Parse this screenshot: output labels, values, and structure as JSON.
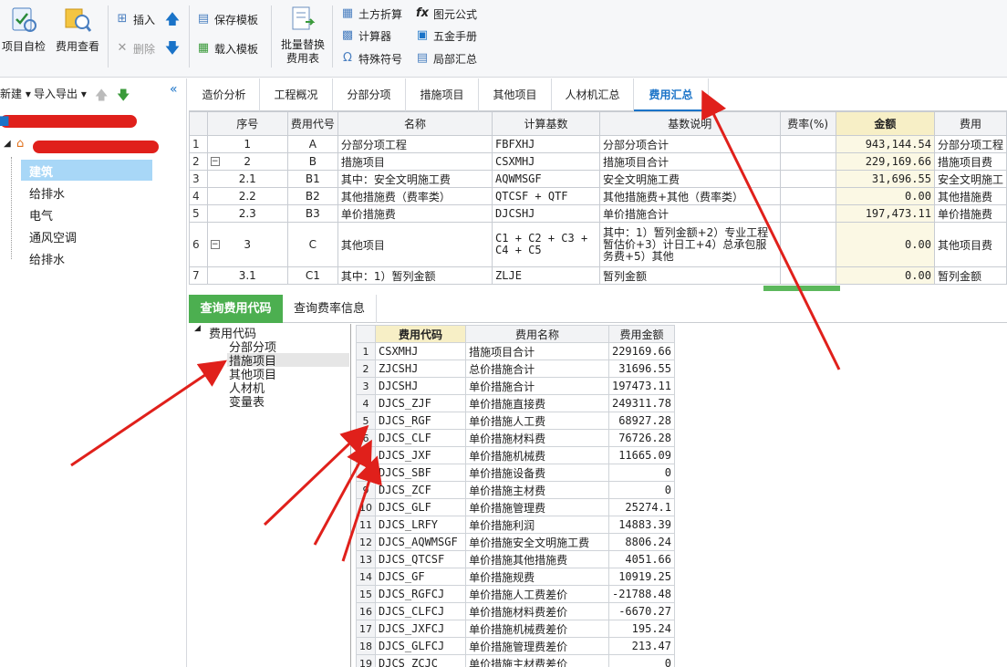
{
  "ribbon": {
    "project_check": "项目自检",
    "fee_view": "费用查看",
    "insert": "插入",
    "delete": "删除",
    "save_template": "保存模板",
    "load_template": "载入模板",
    "batch_replace_line1": "批量替换",
    "batch_replace_line2": "费用表",
    "earthwork": "土方折算",
    "formula": "图元公式",
    "calculator": "计算器",
    "hardware_manual": "五金手册",
    "special_symbol": "特殊符号",
    "partial_summary": "局部汇总"
  },
  "leftnav": {
    "new_label": "新建",
    "import_export": "导入导出",
    "tree": [
      "建筑",
      "给排水",
      "电气",
      "通风空调",
      "给排水"
    ]
  },
  "tabs": [
    "造价分析",
    "工程概况",
    "分部分项",
    "措施项目",
    "其他项目",
    "人材机汇总",
    "费用汇总"
  ],
  "main_table": {
    "headers": [
      "序号",
      "费用代号",
      "名称",
      "计算基数",
      "基数说明",
      "费率(%)",
      "金额",
      "费用"
    ],
    "rows": [
      {
        "rn": "1",
        "seq": "1",
        "code": "A",
        "name": "分部分项工程",
        "base": "FBFXHJ",
        "desc": "分部分项合计",
        "rate": "",
        "amount": "943,144.54",
        "type": "分部分项工程"
      },
      {
        "rn": "2",
        "seq": "2",
        "code": "B",
        "name": "措施项目",
        "base": "CSXMHJ",
        "desc": "措施项目合计",
        "rate": "",
        "amount": "229,169.66",
        "type": "措施项目费"
      },
      {
        "rn": "3",
        "seq": "2.1",
        "code": "B1",
        "name": "其中：安全文明施工费",
        "base": "AQWMSGF",
        "desc": "安全文明施工费",
        "rate": "",
        "amount": "31,696.55",
        "type": "安全文明施工"
      },
      {
        "rn": "4",
        "seq": "2.2",
        "code": "B2",
        "name": "其他措施费（费率类）",
        "base": "QTCSF + QTF",
        "desc": "其他措施费+其他（费率类）",
        "rate": "",
        "amount": "0.00",
        "type": "其他措施费"
      },
      {
        "rn": "5",
        "seq": "2.3",
        "code": "B3",
        "name": "单价措施费",
        "base": "DJCSHJ",
        "desc": "单价措施合计",
        "rate": "",
        "amount": "197,473.11",
        "type": "单价措施费"
      },
      {
        "rn": "6",
        "seq": "3",
        "code": "C",
        "name": "其他项目",
        "base": "C1 + C2 + C3 + C4 + C5",
        "desc": "其中：1）暂列金额+2）专业工程暂估价+3）计日工+4）总承包服务费+5）其他",
        "rate": "",
        "amount": "0.00",
        "type": "其他项目费"
      },
      {
        "rn": "7",
        "seq": "3.1",
        "code": "C1",
        "name": "其中：1）暂列金额",
        "base": "ZLJE",
        "desc": "暂列金额",
        "rate": "",
        "amount": "0.00",
        "type": "暂列金额"
      }
    ]
  },
  "bottom_tabs": [
    "查询费用代码",
    "查询费率信息"
  ],
  "code_tree": {
    "root": "费用代码",
    "children": [
      "分部分项",
      "措施项目",
      "其他项目",
      "人材机",
      "变量表"
    ]
  },
  "code_table": {
    "headers": [
      "费用代码",
      "费用名称",
      "费用金额"
    ],
    "rows": [
      [
        "1",
        "CSXMHJ",
        "措施项目合计",
        "229169.66"
      ],
      [
        "2",
        "ZJCSHJ",
        "总价措施合计",
        "31696.55"
      ],
      [
        "3",
        "DJCSHJ",
        "单价措施合计",
        "197473.11"
      ],
      [
        "4",
        "DJCS_ZJF",
        "单价措施直接费",
        "249311.78"
      ],
      [
        "5",
        "DJCS_RGF",
        "单价措施人工费",
        "68927.28"
      ],
      [
        "6",
        "DJCS_CLF",
        "单价措施材料费",
        "76726.28"
      ],
      [
        "7",
        "DJCS_JXF",
        "单价措施机械费",
        "11665.09"
      ],
      [
        "8",
        "DJCS_SBF",
        "单价措施设备费",
        "0"
      ],
      [
        "9",
        "DJCS_ZCF",
        "单价措施主材费",
        "0"
      ],
      [
        "10",
        "DJCS_GLF",
        "单价措施管理费",
        "25274.1"
      ],
      [
        "11",
        "DJCS_LRFY",
        "单价措施利润",
        "14883.39"
      ],
      [
        "12",
        "DJCS_AQWMSGF",
        "单价措施安全文明施工费",
        "8806.24"
      ],
      [
        "13",
        "DJCS_QTCSF",
        "单价措施其他措施费",
        "4051.66"
      ],
      [
        "14",
        "DJCS_GF",
        "单价措施规费",
        "10919.25"
      ],
      [
        "15",
        "DJCS_RGFCJ",
        "单价措施人工费差价",
        "-21788.48"
      ],
      [
        "16",
        "DJCS_CLFCJ",
        "单价措施材料费差价",
        "-6670.27"
      ],
      [
        "17",
        "DJCS_JXFCJ",
        "单价措施机械费差价",
        "195.24"
      ],
      [
        "18",
        "DJCS_GLFCJ",
        "单价措施管理费差价",
        "213.47"
      ],
      [
        "19",
        "DJCS_ZCJC",
        "单价措施主材费差价",
        "0"
      ]
    ]
  },
  "colors": {
    "accent": "#1a73c8",
    "green": "#4caf50",
    "amount_bg": "#f7efc6",
    "annotation_red": "#e0201b"
  }
}
